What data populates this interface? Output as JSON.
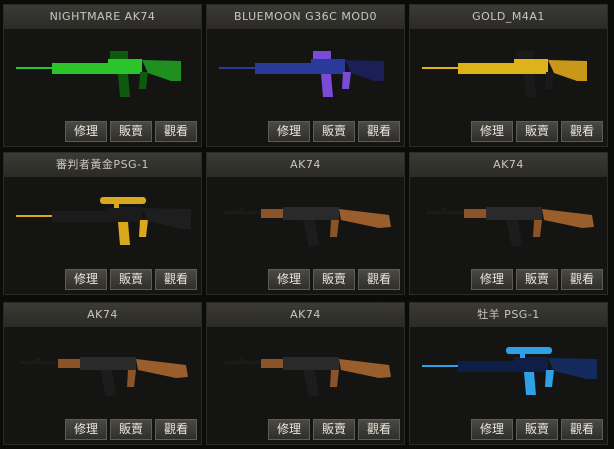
{
  "items": [
    {
      "title": "NIGHTMARE AK74",
      "style": "nightmare",
      "actions": [
        "修理",
        "販賣",
        "觀看"
      ]
    },
    {
      "title": "BLUEMOON G36C MOD0",
      "style": "bluemoon",
      "actions": [
        "修理",
        "販賣",
        "觀看"
      ]
    },
    {
      "title": "GOLD_M4A1",
      "style": "gold_m4",
      "actions": [
        "修理",
        "販賣",
        "觀看"
      ]
    },
    {
      "title": "審判者黃金PSG-1",
      "style": "gold_psg",
      "actions": [
        "修理",
        "販賣",
        "觀看"
      ]
    },
    {
      "title": "AK74",
      "style": "ak",
      "actions": [
        "修理",
        "販賣",
        "觀看"
      ]
    },
    {
      "title": "AK74",
      "style": "ak",
      "actions": [
        "修理",
        "販賣",
        "觀看"
      ]
    },
    {
      "title": "AK74",
      "style": "ak",
      "actions": [
        "修理",
        "販賣",
        "觀看"
      ]
    },
    {
      "title": "AK74",
      "style": "ak",
      "actions": [
        "修理",
        "販賣",
        "觀看"
      ]
    },
    {
      "title": "牡羊 PSG-1",
      "style": "aries_psg",
      "actions": [
        "修理",
        "販賣",
        "觀看"
      ]
    }
  ],
  "palette": {
    "nightmare": {
      "body": "#2bc42b",
      "accent": "#0d5a0d",
      "stock": "#1f8f1f"
    },
    "bluemoon": {
      "body": "#2a3a9a",
      "accent": "#7a4bd6",
      "stock": "#1a1f55"
    },
    "gold_m4": {
      "body": "#e0b21a",
      "accent": "#1a1a1a",
      "stock": "#c9971a"
    },
    "gold_psg": {
      "body": "#1b1b1b",
      "accent": "#d8a91c",
      "stock": "#1e1e1e"
    },
    "ak": {
      "body": "#2a2a2a",
      "accent": "#8a5428",
      "stock": "#9a5e2c"
    },
    "aries_psg": {
      "body": "#0f1e46",
      "accent": "#2fa0e6",
      "stock": "#142a5c"
    }
  }
}
